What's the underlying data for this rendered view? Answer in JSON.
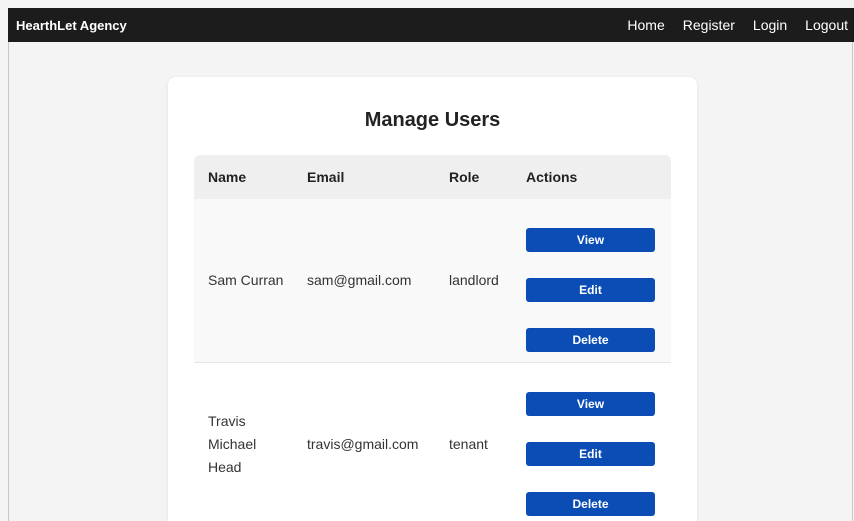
{
  "header": {
    "brand": "HearthLet Agency",
    "nav": [
      "Home",
      "Register",
      "Login",
      "Logout"
    ]
  },
  "page": {
    "title": "Manage Users"
  },
  "table": {
    "columns": [
      "Name",
      "Email",
      "Role",
      "Actions"
    ],
    "rows": [
      {
        "name": "Sam Curran",
        "email": "sam@gmail.com",
        "role": "landlord"
      },
      {
        "name": "Travis Michael Head",
        "email": "travis@gmail.com",
        "role": "tenant"
      }
    ],
    "actions": {
      "view": "View",
      "edit": "Edit",
      "delete": "Delete"
    }
  },
  "colors": {
    "topbar": "#1c1c1c",
    "button": "#0b4db5",
    "header_row": "#efefef"
  }
}
